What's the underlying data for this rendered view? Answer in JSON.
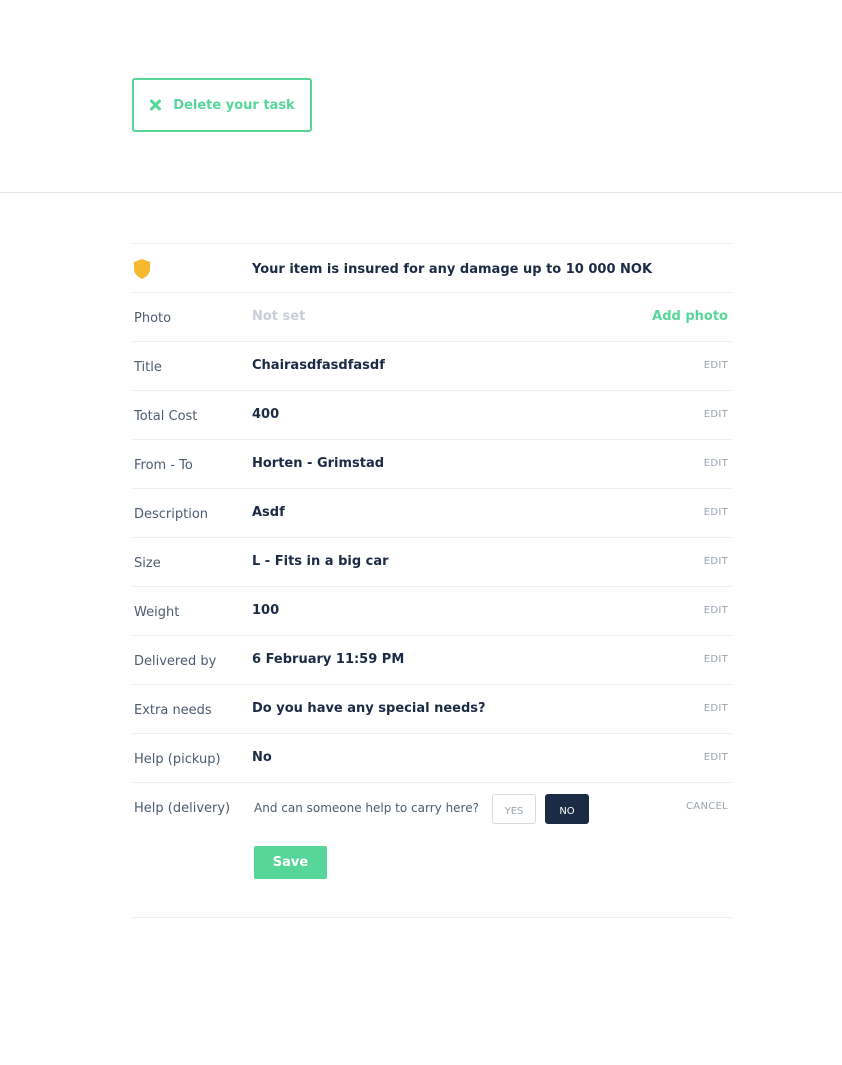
{
  "header": {
    "delete_button_label": "Delete your task"
  },
  "insurance": {
    "text": "Your item is insured for any damage up to 10 000 NOK"
  },
  "fields": [
    {
      "label": "Photo",
      "value": "Not set",
      "action": "Add photo"
    },
    {
      "label": "Title",
      "value": "Chairasdfasdfasdf",
      "action": "EDIT"
    },
    {
      "label": "Total Cost",
      "value": "400",
      "action": "EDIT"
    },
    {
      "label": "From - To",
      "value": "Horten - Grimstad",
      "action": "EDIT"
    },
    {
      "label": "Description",
      "value": "Asdf",
      "action": "EDIT"
    },
    {
      "label": "Size",
      "value": "L - Fits in a big car",
      "action": "EDIT"
    },
    {
      "label": "Weight",
      "value": "100",
      "action": "EDIT"
    },
    {
      "label": "Delivered by",
      "value": "6 February 11:59 PM",
      "action": "EDIT"
    },
    {
      "label": "Extra needs",
      "value": "Do you have any special needs?",
      "action": "EDIT"
    },
    {
      "label": "Help (pickup)",
      "value": "No",
      "action": "EDIT"
    }
  ],
  "help_delivery": {
    "label": "Help (delivery)",
    "question": "And can someone help to carry here?",
    "yes_label": "YES",
    "no_label": "NO",
    "selected": "NO",
    "cancel_label": "CANCEL",
    "save_label": "Save"
  },
  "colors": {
    "accent": "#57d69a",
    "navy": "#1b2a45",
    "shield": "#f5b82e"
  }
}
